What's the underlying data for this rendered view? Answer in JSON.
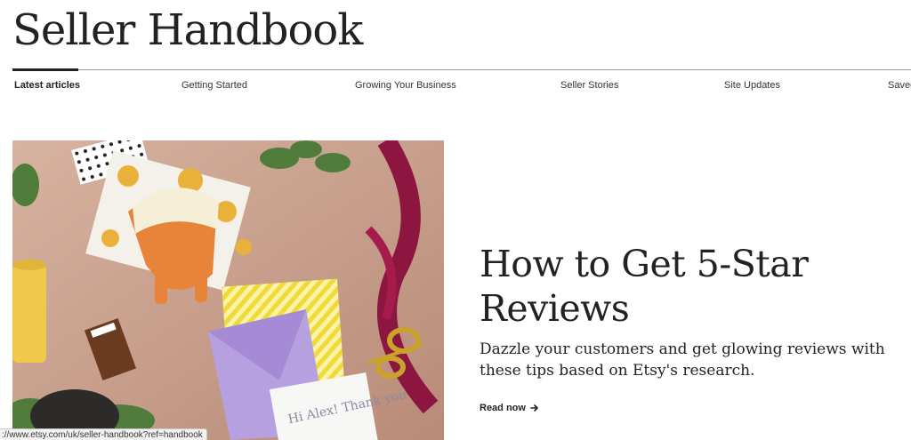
{
  "header": {
    "title": "Seller Handbook"
  },
  "nav": {
    "items": [
      {
        "label": "Latest articles",
        "active": true
      },
      {
        "label": "Getting Started",
        "active": false
      },
      {
        "label": "Growing Your Business",
        "active": false
      },
      {
        "label": "Seller Stories",
        "active": false
      },
      {
        "label": "Site Updates",
        "active": false
      },
      {
        "label": "Saved",
        "active": false
      }
    ]
  },
  "featured": {
    "headline": "How to Get 5-Star Reviews",
    "summary": "Dazzle your customers and get glowing reviews with these tips based on Etsy's research.",
    "cta_label": "Read now",
    "image_note_text": "Hi Alex! Thank you"
  },
  "status_bar": {
    "url": "://www.etsy.com/uk/seller-handbook?ref=handbook"
  },
  "colors": {
    "text": "#222222",
    "nav_divider": "#9a9a9a",
    "background": "#ffffff"
  },
  "icons": {
    "cta": "arrow-right-icon"
  }
}
